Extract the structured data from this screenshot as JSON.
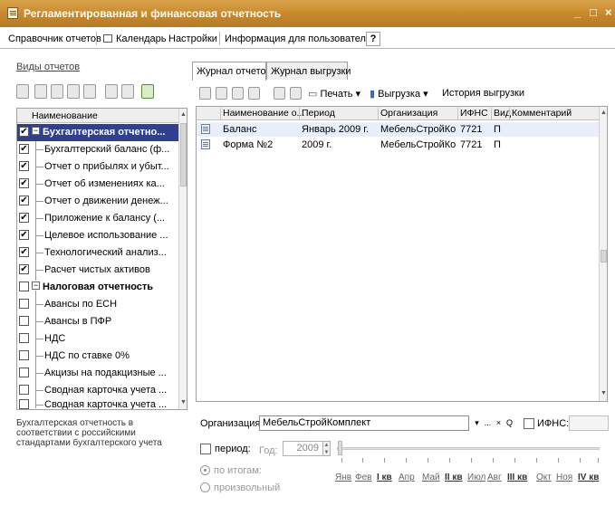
{
  "window": {
    "title": "Регламентированная и финансовая отчетность",
    "controls": [
      "_",
      "□",
      "×"
    ]
  },
  "menu": {
    "items": [
      "Справочник отчетов",
      "Календарь",
      "Настройки",
      "Информация для пользователей"
    ],
    "help": "?"
  },
  "left_panel": {
    "header": "Виды отчетов",
    "column_header": "Наименование",
    "tree": [
      {
        "label": "Бухгалтерская отчетно...",
        "checked": true,
        "group": true,
        "selected": true
      },
      {
        "label": "Бухгалтерский баланс (ф...",
        "checked": true
      },
      {
        "label": "Отчет о прибылях и убыт...",
        "checked": true
      },
      {
        "label": "Отчет об изменениях ка...",
        "checked": true
      },
      {
        "label": "Отчет о движении денеж...",
        "checked": true
      },
      {
        "label": "Приложение к балансу (...",
        "checked": true
      },
      {
        "label": "Целевое использование ...",
        "checked": true
      },
      {
        "label": "Технологический анализ...",
        "checked": true
      },
      {
        "label": "Расчет чистых активов",
        "checked": true
      },
      {
        "label": "Налоговая отчетность",
        "checked": false,
        "group": true
      },
      {
        "label": "Авансы по ЕСН",
        "checked": false
      },
      {
        "label": "Авансы в ПФР",
        "checked": false
      },
      {
        "label": "НДС",
        "checked": false
      },
      {
        "label": "НДС по ставке 0%",
        "checked": false
      },
      {
        "label": "Акцизы на подакцизные ...",
        "checked": false
      },
      {
        "label": "Сводная карточка учета ...",
        "checked": false
      },
      {
        "label": "Сводная карточка учета ...",
        "checked": false
      }
    ],
    "description": "Бухгалтерская отчетность в соответствии с российскими стандартами бухгалтерского учета"
  },
  "right_panel": {
    "tabs": [
      "Журнал отчетов",
      "Журнал выгрузки"
    ],
    "toolbar": {
      "print": "Печать",
      "export": "Выгрузка",
      "history": "История выгрузки"
    },
    "columns": [
      "Наименование о...",
      "Период",
      "Организация",
      "ИФНС",
      "Вид",
      "Комментарий"
    ],
    "rows": [
      {
        "name": "Баланс",
        "period": "Январь 2009 г.",
        "org": "МебельСтройКо...",
        "ifns": "7721",
        "kind": "П",
        "comment": ""
      },
      {
        "name": "Форма №2",
        "period": "2009 г.",
        "org": "МебельСтройКо...",
        "ifns": "7721",
        "kind": "П",
        "comment": ""
      }
    ]
  },
  "filters": {
    "org_label": "Организация:",
    "org_value": "МебельСтройКомплект",
    "org_buttons": [
      "▾",
      "...",
      "×",
      "Q"
    ],
    "ifns_label": "ИФНС:",
    "period_label": "период:",
    "year_label": "Год:",
    "year_value": "2009",
    "radio_totals": "по итогам:",
    "radio_custom": "произвольный",
    "months": [
      "Янв",
      "Фев",
      "I кв",
      "Апр",
      "Май",
      "II кв",
      "Июл",
      "Авг",
      "III кв",
      "Окт",
      "Ноя",
      "IV кв"
    ],
    "quarters": [
      "I кв",
      "II кв",
      "III кв",
      "IV кв"
    ]
  }
}
